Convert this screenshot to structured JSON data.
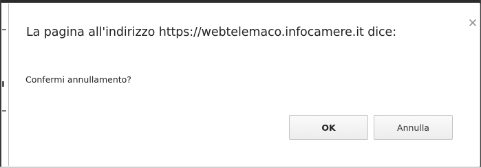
{
  "dialog": {
    "title": "La pagina all'indirizzo https://webtelemaco.infocamere.it dice:",
    "message": "Confermi annullamento?",
    "close_icon": "close-icon",
    "buttons": {
      "ok_label": "OK",
      "cancel_label": "Annulla"
    }
  },
  "colors": {
    "text": "#222222",
    "button_border": "#c4c4c4",
    "button_bg": "#f4f4f4",
    "close_icon": "#9a9a9a"
  }
}
